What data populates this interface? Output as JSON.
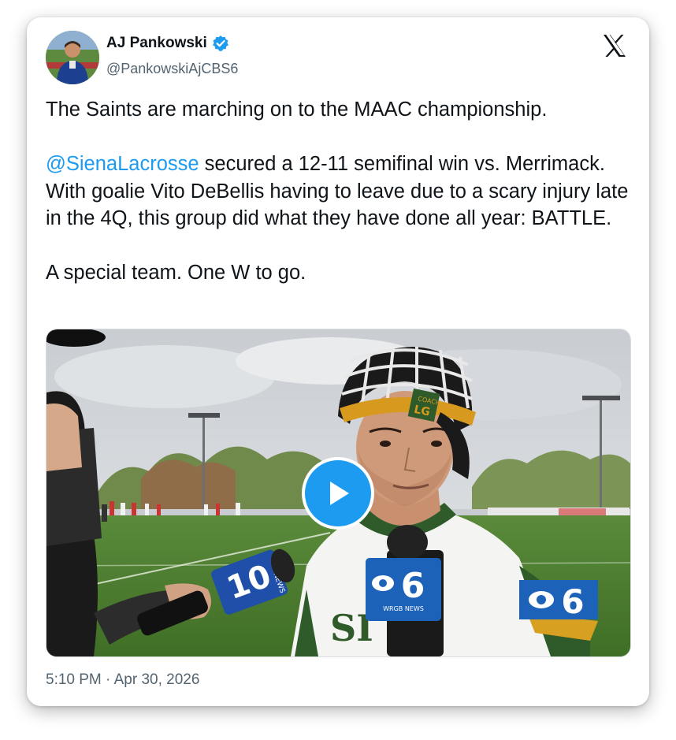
{
  "author": {
    "display_name": "AJ Pankowski",
    "handle": "@PankowskiAjCBS6",
    "verified": true
  },
  "tweet": {
    "line1": "The Saints are marching on to the MAAC championship.",
    "mention": "@SienaLacrosse",
    "line2_rest": " secured a 12-11 semifinal win vs. Merrimack. With goalie Vito DeBellis having to leave due to a scary injury late in the 4Q, this group did what they have done all year: BATTLE.",
    "line3": "A special team. One W to go.",
    "timestamp": "5:10 PM · Apr 30, 2026"
  },
  "media": {
    "type": "video",
    "play_icon": "play-icon",
    "overlay_logo_text": "6",
    "mic_logo_text": "6",
    "mic_logo_sub": "WRGB NEWS",
    "mic2_text": "NEWS",
    "helmet_tag_top": "COACH",
    "helmet_tag_bottom": "LG",
    "jersey_text": "SI"
  },
  "colors": {
    "accent": "#1d9bf0",
    "text": "#0f1419",
    "muted": "#536471",
    "cbs_blue": "#1c62b9"
  },
  "icons": {
    "close": "x-logo-icon",
    "verified": "verified-badge-icon"
  }
}
